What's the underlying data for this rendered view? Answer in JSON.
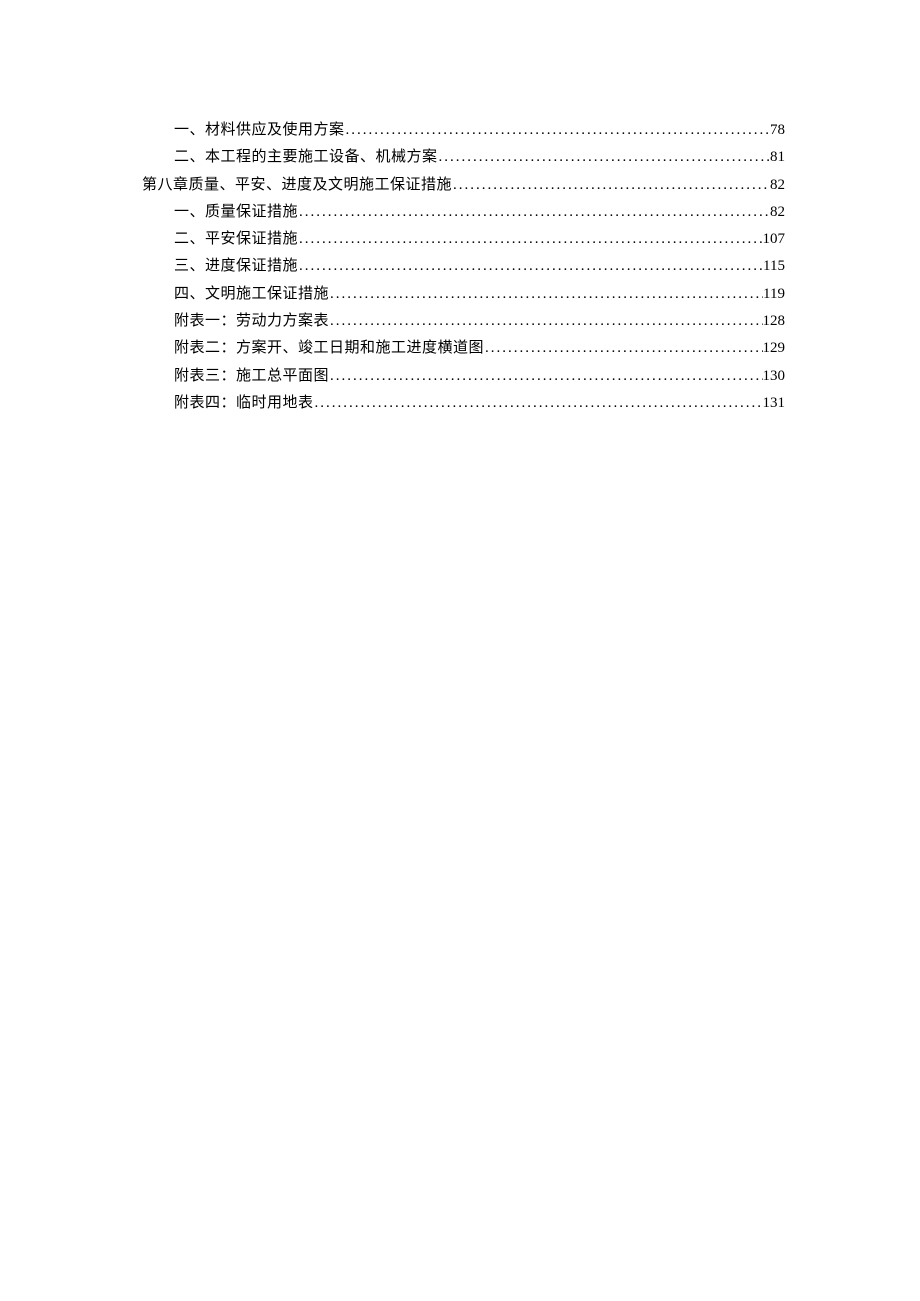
{
  "toc": [
    {
      "level": 2,
      "title": "一、材料供应及使用方案",
      "page": "78"
    },
    {
      "level": 2,
      "title": "二、本工程的主要施工设备、机械方案",
      "page": "81"
    },
    {
      "level": 1,
      "title": "第八章质量、平安、进度及文明施工保证措施",
      "page": "82"
    },
    {
      "level": 2,
      "title": "一、质量保证措施",
      "page": "82"
    },
    {
      "level": 2,
      "title": "二、平安保证措施",
      "page": "107"
    },
    {
      "level": 2,
      "title": "三、进度保证措施",
      "page": "115"
    },
    {
      "level": 2,
      "title": "四、文明施工保证措施",
      "page": "119"
    },
    {
      "level": 2,
      "title": "附表一：劳动力方案表",
      "page": "128"
    },
    {
      "level": 2,
      "title": "附表二：方案开、竣工日期和施工进度横道图",
      "page": "129"
    },
    {
      "level": 2,
      "title": "附表三：施工总平面图",
      "page": "130"
    },
    {
      "level": 2,
      "title": "附表四：临时用地表",
      "page": "131"
    }
  ]
}
